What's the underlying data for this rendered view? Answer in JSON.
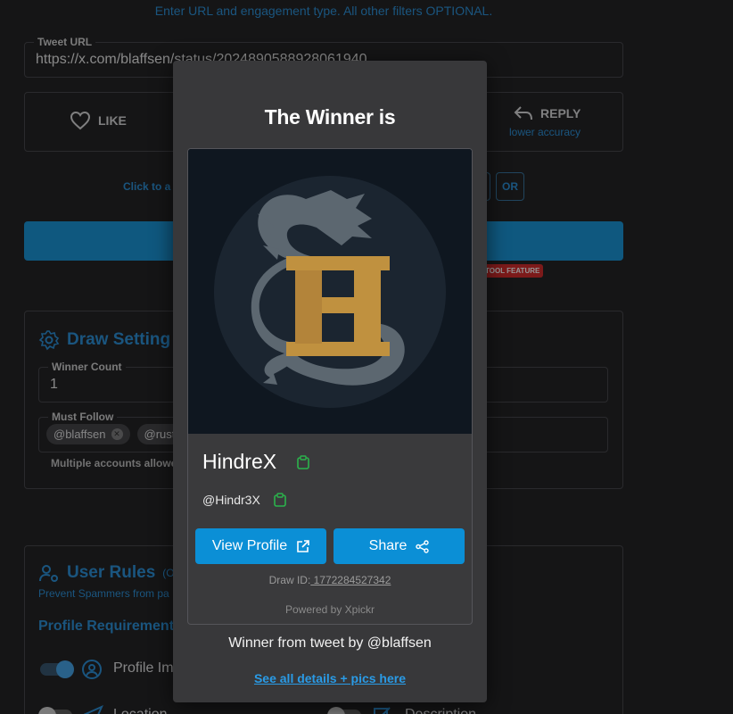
{
  "background": {
    "hint": "Enter URL and engagement type. All other filters OPTIONAL.",
    "tweet_url": {
      "label": "Tweet URL",
      "value": "https://x.com/blaffsen/status/2024890588928061940"
    },
    "engagement": {
      "like_label": "LIKE",
      "reply_label": "REPLY",
      "reply_sub": "lower accuracy"
    },
    "click_to": "Click to a",
    "or_label": "OR",
    "badge": "TOOL FEATURE",
    "draw_settings": {
      "title": "Draw Setting",
      "winner_count": {
        "label": "Winner Count",
        "value": "1"
      },
      "must_follow": {
        "label": "Must Follow",
        "chips": [
          "@blaffsen",
          "@rustr"
        ]
      },
      "helper": "Multiple accounts allowe"
    },
    "user_rules": {
      "title": "User Rules",
      "title_suffix": "(O",
      "subtext": "Prevent Spammers from pa",
      "requirements_title": "Profile Requirement",
      "rules": [
        {
          "label": "Profile Im"
        },
        {
          "label": "Location"
        },
        {
          "label": "Description"
        }
      ]
    }
  },
  "modal": {
    "title": "The Winner is",
    "winner": {
      "name": "HindreX",
      "handle": "@Hindr3X"
    },
    "view_profile_label": "View Profile",
    "share_label": "Share",
    "draw_id_label": "Draw ID:",
    "draw_id_value": " 1772284527342",
    "powered_by": "Powered by Xpickr",
    "from_tweet": "Winner from tweet by @blaffsen",
    "details_link": "See all details + pics here"
  },
  "colors": {
    "accent": "#0b8fd6",
    "link": "#2a9be6",
    "copy_icon": "#2bb24c",
    "badge": "#d11f1f",
    "logo_gold": "#c0913f",
    "logo_dragon": "#5c6770"
  }
}
